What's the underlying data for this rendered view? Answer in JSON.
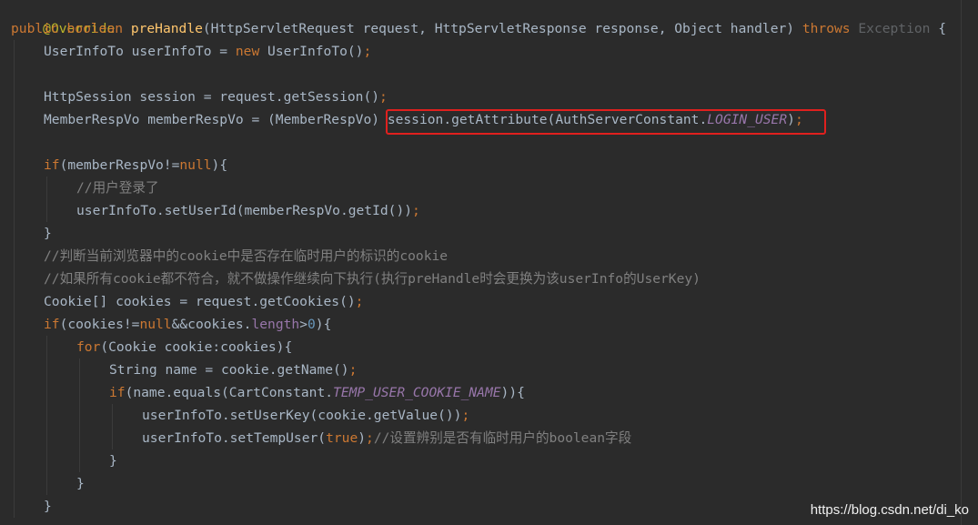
{
  "code": {
    "l0_annotation": "@Override",
    "l1_public": "public ",
    "l1_boolean": "boolean ",
    "l1_method": "preHandle",
    "l1_sig": "(HttpServletRequest request, HttpServletResponse response, Object handler) ",
    "l1_throws": "throws ",
    "l1_exception": "Exception",
    "l1_brace": " {",
    "l2_a": "UserInfoTo userInfoTo = ",
    "l2_new": "new ",
    "l2_b": "UserInfoTo()",
    "l2_semi": ";",
    "l4_a": "HttpSession session = request.getSession()",
    "l4_semi": ";",
    "l5_a": "MemberRespVo memberRespVo = (MemberRespVo) ",
    "l5_b": "session.getAttribute(AuthServerConstant.",
    "l5_const": "LOGIN_USER",
    "l5_c": ")",
    "l5_semi": ";",
    "l7_if": "if",
    "l7_a": "(memberRespVo!=",
    "l7_null": "null",
    "l7_b": "){",
    "l8_comment": "//用户登录了",
    "l9_a": "userInfoTo.setUserId(memberRespVo.getId())",
    "l9_semi": ";",
    "l10_brace": "}",
    "l11_comment": "//判断当前浏览器中的cookie中是否存在临时用户的标识的cookie",
    "l12_comment": "//如果所有cookie都不符合，就不做操作继续向下执行(执行preHandle时会更换为该userInfo的UserKey)",
    "l13_a": "Cookie[] cookies = request.getCookies()",
    "l13_semi": ";",
    "l14_if": "if",
    "l14_a": "(cookies!=",
    "l14_null": "null",
    "l14_b": "&&cookies.",
    "l14_length": "length",
    "l14_c": ">",
    "l14_zero": "0",
    "l14_d": "){",
    "l15_for": "for",
    "l15_a": "(Cookie cookie:cookies){",
    "l16_a": "String name = cookie.getName()",
    "l16_semi": ";",
    "l17_if": "if",
    "l17_a": "(name.equals(CartConstant.",
    "l17_const": "TEMP_USER_COOKIE_NAME",
    "l17_b": ")){",
    "l18_a": "userInfoTo.setUserKey(cookie.getValue())",
    "l18_semi": ";",
    "l19_a": "userInfoTo.setTempUser(",
    "l19_true": "true",
    "l19_b": ")",
    "l19_semi": ";",
    "l19_comment": "//设置辨别是否有临时用户的boolean字段",
    "l20_brace": "}",
    "l21_brace": "}",
    "l22_brace": "}"
  },
  "watermark": "https://blog.csdn.net/di_ko",
  "colors": {
    "background": "#2b2b2b",
    "keyword": "#cc7832",
    "annotation": "#bbb529",
    "method": "#ffc66d",
    "comment": "#808080",
    "constant": "#9876aa",
    "highlight_box": "#e0201e"
  }
}
